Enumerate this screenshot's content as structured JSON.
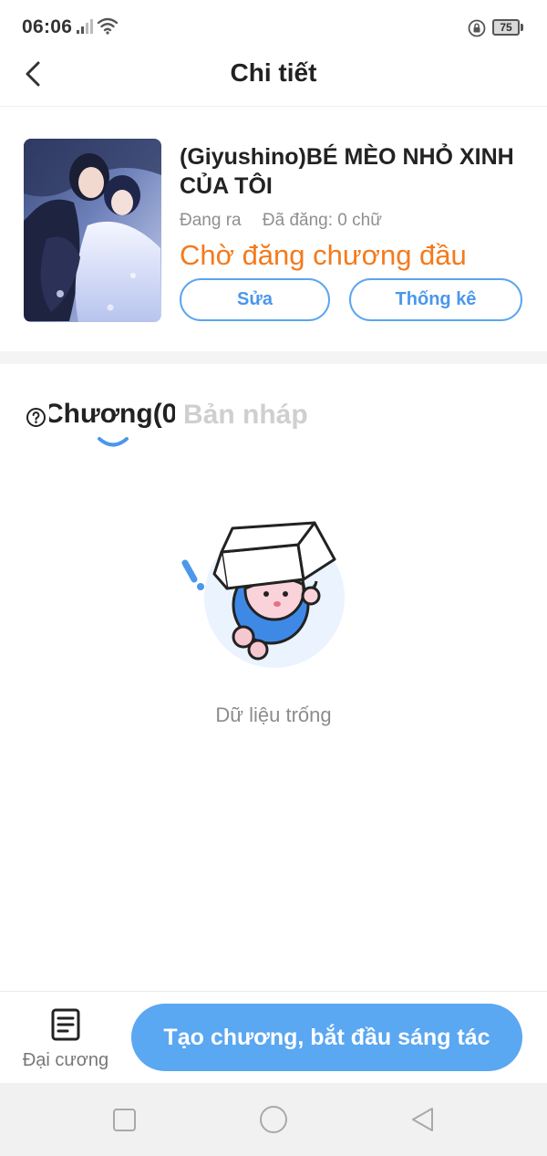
{
  "status_bar": {
    "time": "06:06",
    "battery_level": "75",
    "icons": [
      "signal-icon",
      "wifi-icon",
      "rotation-lock-icon",
      "battery-icon"
    ]
  },
  "nav": {
    "title": "Chi tiết",
    "back_icon": "chevron-left-icon"
  },
  "book": {
    "title": "(Giyushino)BÉ MÈO NHỎ XINH CỦA TÔI",
    "status_label": "Đang ra",
    "word_count_label": "Đã đăng: 0 chữ",
    "publish_status": "Chờ đăng chương đầu",
    "edit_button": "Sửa",
    "stats_button": "Thống kê"
  },
  "tabs": {
    "chapter_label": "Chương(0)",
    "draft_label": "Bản nháp",
    "active": "chapter"
  },
  "empty_state": {
    "text": "Dữ liệu trống"
  },
  "bottom_bar": {
    "outline_label": "Đại cương",
    "create_button": "Tạo chương, bắt đầu sáng tác"
  },
  "colors": {
    "accent_blue": "#5aa7f2",
    "status_orange": "#f47a1d",
    "muted_gray": "#8f8f8f"
  }
}
